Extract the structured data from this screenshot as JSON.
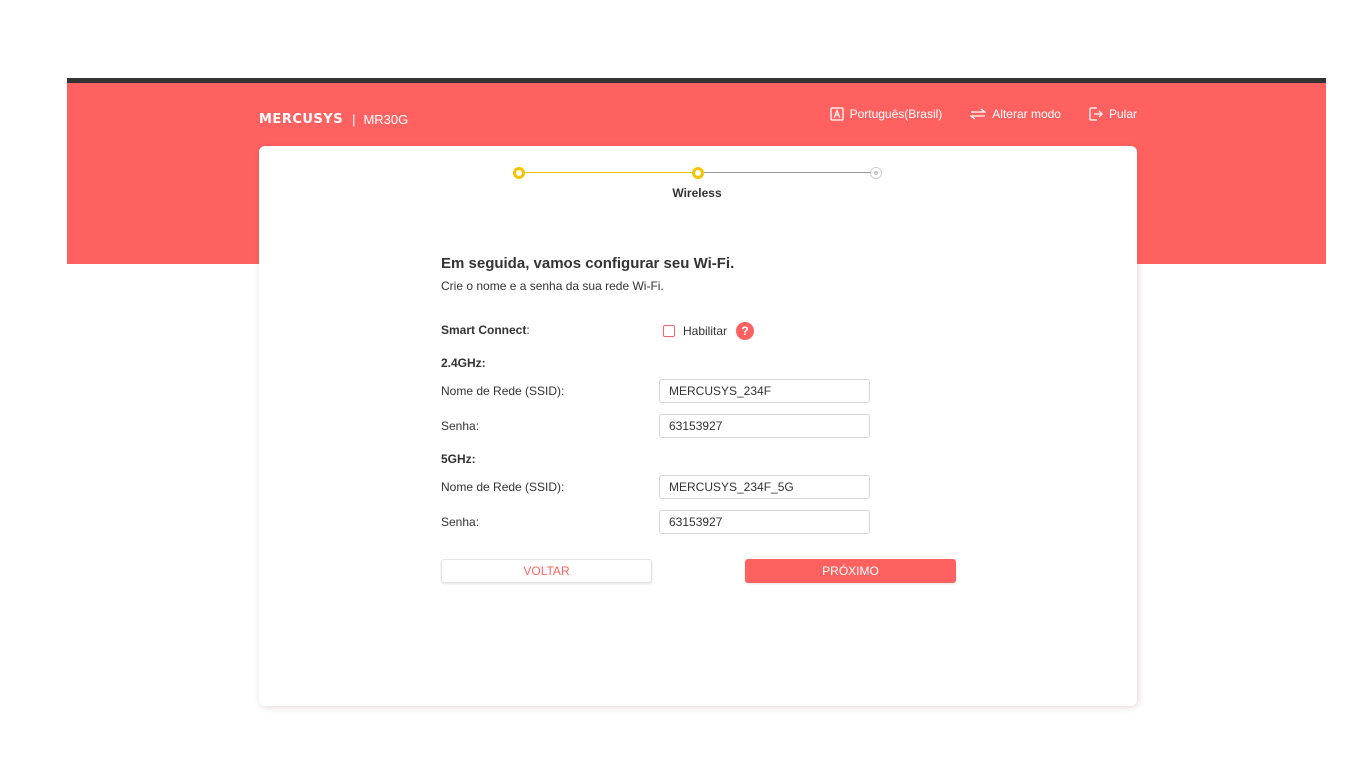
{
  "brand": {
    "logo": "MERCUSYS",
    "separator": "|",
    "model": "MR30G"
  },
  "top_actions": [
    {
      "label": "Português(Brasil)",
      "icon": "language-icon"
    },
    {
      "label": "Alterar modo",
      "icon": "switch-mode-icon"
    },
    {
      "label": "Pular",
      "icon": "skip-exit-icon"
    }
  ],
  "progress": {
    "steps_total": 3,
    "current_step": 2,
    "current_label": "Wireless",
    "active_color": "#f5c400"
  },
  "form": {
    "title": "Em seguida, vamos configurar seu Wi-Fi.",
    "subtitle": "Crie o nome e a senha da sua rede Wi-Fi.",
    "smart_connect": {
      "label": "Smart Connect",
      "label_suffix": ":",
      "option": "Habilitar",
      "checked": false
    },
    "band_24": {
      "title": "2.4GHz:",
      "ssid_label": "Nome de Rede (SSID):",
      "ssid_value": "MERCUSYS_234F",
      "password_label": "Senha:",
      "password_value": "63153927"
    },
    "band_5": {
      "title": "5GHz:",
      "ssid_label": "Nome de Rede (SSID):",
      "ssid_value": "MERCUSYS_234F_5G",
      "password_label": "Senha:",
      "password_value": "63153927"
    }
  },
  "buttons": {
    "back": "VOLTAR",
    "next": "PRÓXIMO"
  },
  "colors": {
    "accent": "#ff6161",
    "header_bar": "#333333",
    "step_active": "#f5c400"
  }
}
